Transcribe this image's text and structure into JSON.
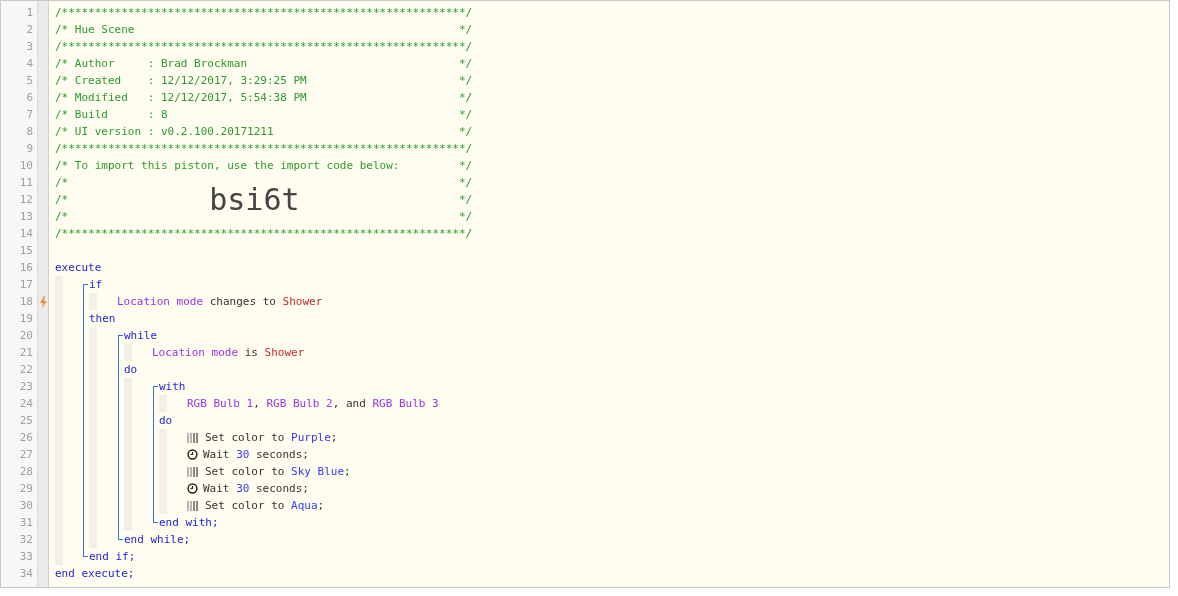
{
  "gutter": [
    {
      "number": "1",
      "trigger": false
    },
    {
      "number": "2",
      "trigger": false
    },
    {
      "number": "3",
      "trigger": false
    },
    {
      "number": "4",
      "trigger": false
    },
    {
      "number": "5",
      "trigger": false
    },
    {
      "number": "6",
      "trigger": false
    },
    {
      "number": "7",
      "trigger": false
    },
    {
      "number": "8",
      "trigger": false
    },
    {
      "number": "9",
      "trigger": false
    },
    {
      "number": "10",
      "trigger": false
    },
    {
      "number": "11",
      "trigger": false
    },
    {
      "number": "12",
      "trigger": false
    },
    {
      "number": "13",
      "trigger": false
    },
    {
      "number": "14",
      "trigger": false
    },
    {
      "number": "15",
      "trigger": false
    },
    {
      "number": "16",
      "trigger": false
    },
    {
      "number": "17",
      "trigger": false
    },
    {
      "number": "18",
      "trigger": true
    },
    {
      "number": "19",
      "trigger": false
    },
    {
      "number": "20",
      "trigger": false
    },
    {
      "number": "21",
      "trigger": false
    },
    {
      "number": "22",
      "trigger": false
    },
    {
      "number": "23",
      "trigger": false
    },
    {
      "number": "24",
      "trigger": false
    },
    {
      "number": "25",
      "trigger": false
    },
    {
      "number": "26",
      "trigger": false
    },
    {
      "number": "27",
      "trigger": false
    },
    {
      "number": "28",
      "trigger": false
    },
    {
      "number": "29",
      "trigger": false
    },
    {
      "number": "30",
      "trigger": false
    },
    {
      "number": "31",
      "trigger": false
    },
    {
      "number": "32",
      "trigger": false
    },
    {
      "number": "33",
      "trigger": false
    },
    {
      "number": "34",
      "trigger": false
    }
  ],
  "header": {
    "top": [
      {
        "text": "/*************************************************************/"
      },
      {
        "text": "/* Hue Scene",
        "end": "*/"
      },
      {
        "text": "/*************************************************************/"
      },
      {
        "text": "/* Author     : Brad Brockman",
        "end": "*/"
      },
      {
        "text": "/* Created    : 12/12/2017, 3:29:25 PM",
        "end": "*/"
      },
      {
        "text": "/* Modified   : 12/12/2017, 5:54:38 PM",
        "end": "*/"
      },
      {
        "text": "/* Build      : 8",
        "end": "*/"
      },
      {
        "text": "/* UI version : v0.2.100.20171211",
        "end": "*/"
      },
      {
        "text": "/*************************************************************/"
      },
      {
        "text": "/* To import this piston, use the import code below:",
        "end": "*/"
      }
    ],
    "code_box": {
      "left": [
        "/*",
        "/*",
        "/*"
      ],
      "code": "bsi6t",
      "right": [
        "*/",
        "*/",
        "*/"
      ]
    },
    "bottom": [
      {
        "text": "/*************************************************************/"
      }
    ]
  },
  "program": {
    "kind": "root",
    "sections": [
      {
        "keyword": "execute",
        "children": [
          {
            "kind": "block",
            "sections": [
              {
                "keyword": "if",
                "children": [
                  {
                    "kind": "statement",
                    "tokens": [
                      {
                        "kind": "device",
                        "text": "Location mode"
                      },
                      {
                        "kind": "text",
                        "text": " changes to "
                      },
                      {
                        "kind": "value",
                        "text": "Shower"
                      }
                    ]
                  }
                ]
              },
              {
                "keyword": "then",
                "children": [
                  {
                    "kind": "block",
                    "sections": [
                      {
                        "keyword": "while",
                        "children": [
                          {
                            "kind": "statement",
                            "tokens": [
                              {
                                "kind": "device",
                                "text": "Location mode"
                              },
                              {
                                "kind": "text",
                                "text": " is "
                              },
                              {
                                "kind": "value",
                                "text": "Shower"
                              }
                            ]
                          }
                        ]
                      },
                      {
                        "keyword": "do",
                        "children": [
                          {
                            "kind": "block",
                            "sections": [
                              {
                                "keyword": "with",
                                "children": [
                                  {
                                    "kind": "statement",
                                    "tokens": [
                                      {
                                        "kind": "device",
                                        "text": "RGB Bulb 1"
                                      },
                                      {
                                        "kind": "text",
                                        "text": ", "
                                      },
                                      {
                                        "kind": "device",
                                        "text": "RGB Bulb 2"
                                      },
                                      {
                                        "kind": "text",
                                        "text": ", and "
                                      },
                                      {
                                        "kind": "device",
                                        "text": "RGB Bulb 3"
                                      }
                                    ]
                                  }
                                ]
                              },
                              {
                                "keyword": "do",
                                "children": [
                                  {
                                    "kind": "action",
                                    "tokens": [
                                      {
                                        "kind": "text",
                                        "text": "Set color to "
                                      },
                                      {
                                        "kind": "literal",
                                        "text": "Purple"
                                      },
                                      {
                                        "kind": "text",
                                        "text": ";"
                                      }
                                    ]
                                  },
                                  {
                                    "kind": "wait",
                                    "tokens": [
                                      {
                                        "kind": "text",
                                        "text": "Wait "
                                      },
                                      {
                                        "kind": "literal",
                                        "text": "30"
                                      },
                                      {
                                        "kind": "text",
                                        "text": " seconds;"
                                      }
                                    ]
                                  },
                                  {
                                    "kind": "action",
                                    "tokens": [
                                      {
                                        "kind": "text",
                                        "text": "Set color to "
                                      },
                                      {
                                        "kind": "literal",
                                        "text": "Sky Blue"
                                      },
                                      {
                                        "kind": "text",
                                        "text": ";"
                                      }
                                    ]
                                  },
                                  {
                                    "kind": "wait",
                                    "tokens": [
                                      {
                                        "kind": "text",
                                        "text": "Wait "
                                      },
                                      {
                                        "kind": "literal",
                                        "text": "30"
                                      },
                                      {
                                        "kind": "text",
                                        "text": " seconds;"
                                      }
                                    ]
                                  },
                                  {
                                    "kind": "action",
                                    "tokens": [
                                      {
                                        "kind": "text",
                                        "text": "Set color to "
                                      },
                                      {
                                        "kind": "literal",
                                        "text": "Aqua"
                                      },
                                      {
                                        "kind": "text",
                                        "text": ";"
                                      }
                                    ]
                                  }
                                ]
                              }
                            ],
                            "end": "end with;"
                          }
                        ]
                      }
                    ],
                    "end": "end while;"
                  }
                ]
              }
            ],
            "end": "end if;"
          }
        ]
      }
    ],
    "end": "end execute;"
  }
}
